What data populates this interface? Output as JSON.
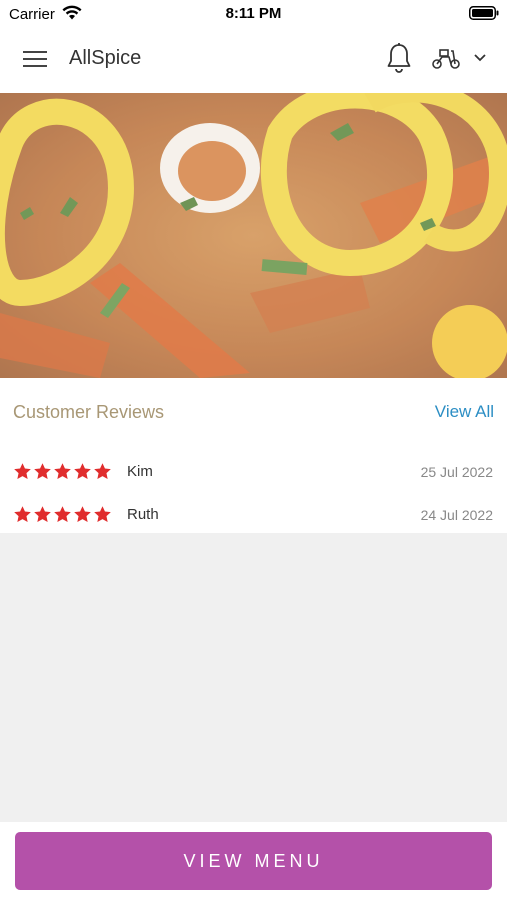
{
  "status_bar": {
    "carrier": "Carrier",
    "time": "8:11 PM",
    "icons": [
      "wifi-icon",
      "battery-icon"
    ]
  },
  "header": {
    "title": "AllSpice",
    "icons": [
      "menu-icon",
      "bell-icon",
      "scooter-icon",
      "chevron-down-icon"
    ]
  },
  "hero": {
    "image": "food-photo"
  },
  "reviews": {
    "heading": "Customer Reviews",
    "view_all": "View All",
    "items": [
      {
        "name": "Kim",
        "date": "25 Jul 2022",
        "rating": 5
      },
      {
        "name": "Ruth",
        "date": "24 Jul 2022",
        "rating": 5
      }
    ]
  },
  "footer": {
    "button_label": "VIEW MENU"
  },
  "colors": {
    "accent": "#b451a9",
    "link": "#2c8ec4",
    "heading": "#a89775",
    "star": "#e02d2d"
  }
}
